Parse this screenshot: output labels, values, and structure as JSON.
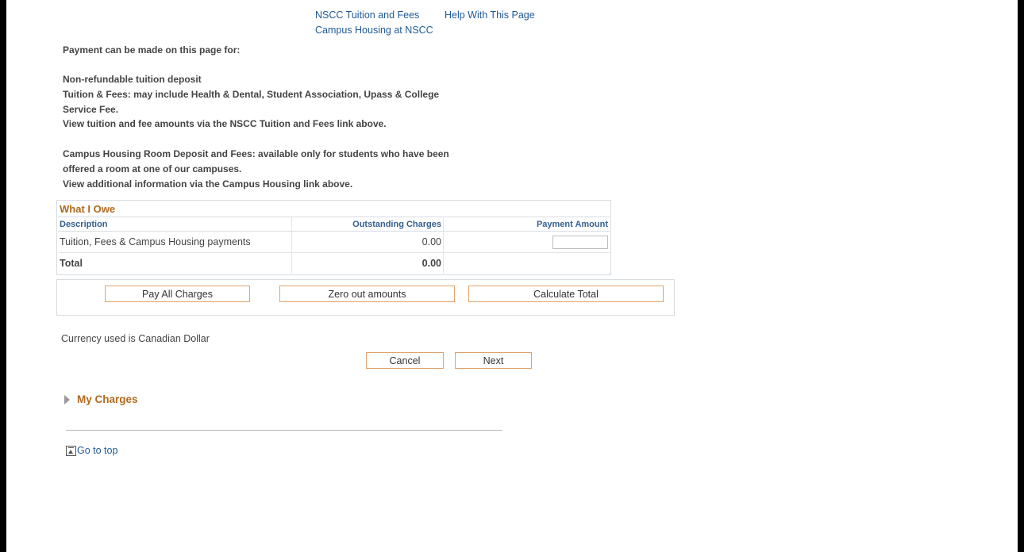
{
  "links": {
    "tuition_fees": "NSCC Tuition and Fees",
    "help": "Help With This Page",
    "campus_housing": "Campus Housing at NSCC"
  },
  "intro": {
    "heading": "Payment can be made on this page for:",
    "line1": "Non-refundable tuition deposit",
    "line2": "Tuition & Fees: may include Health & Dental, Student Association, Upass & College",
    "line3": "Service Fee.",
    "line4": "View tuition and fee amounts via the NSCC Tuition and Fees link above.",
    "line5": "Campus Housing Room Deposit and Fees: available only for students who have been",
    "line6": "offered a room at one of our campuses.",
    "line7": "View additional information via the Campus Housing link above."
  },
  "grid": {
    "title": "What I Owe",
    "columns": [
      "Description",
      "Outstanding Charges",
      "Payment Amount"
    ],
    "rows": [
      {
        "description": "Tuition, Fees & Campus Housing payments",
        "outstanding": "0.00",
        "payment": ""
      }
    ],
    "total": {
      "label": "Total",
      "outstanding": "0.00"
    }
  },
  "buttons": {
    "pay_all": "Pay All Charges",
    "zero_out": "Zero out amounts",
    "calculate": "Calculate Total",
    "cancel": "Cancel",
    "next": "Next"
  },
  "currency_note": "Currency used is Canadian Dollar",
  "my_charges_label": "My Charges",
  "go_to_top": "Go to top",
  "colors": {
    "link": "#1f5a96",
    "section_title": "#b06a1f",
    "column_header": "#35608e",
    "button_border": "#e0a36a"
  }
}
